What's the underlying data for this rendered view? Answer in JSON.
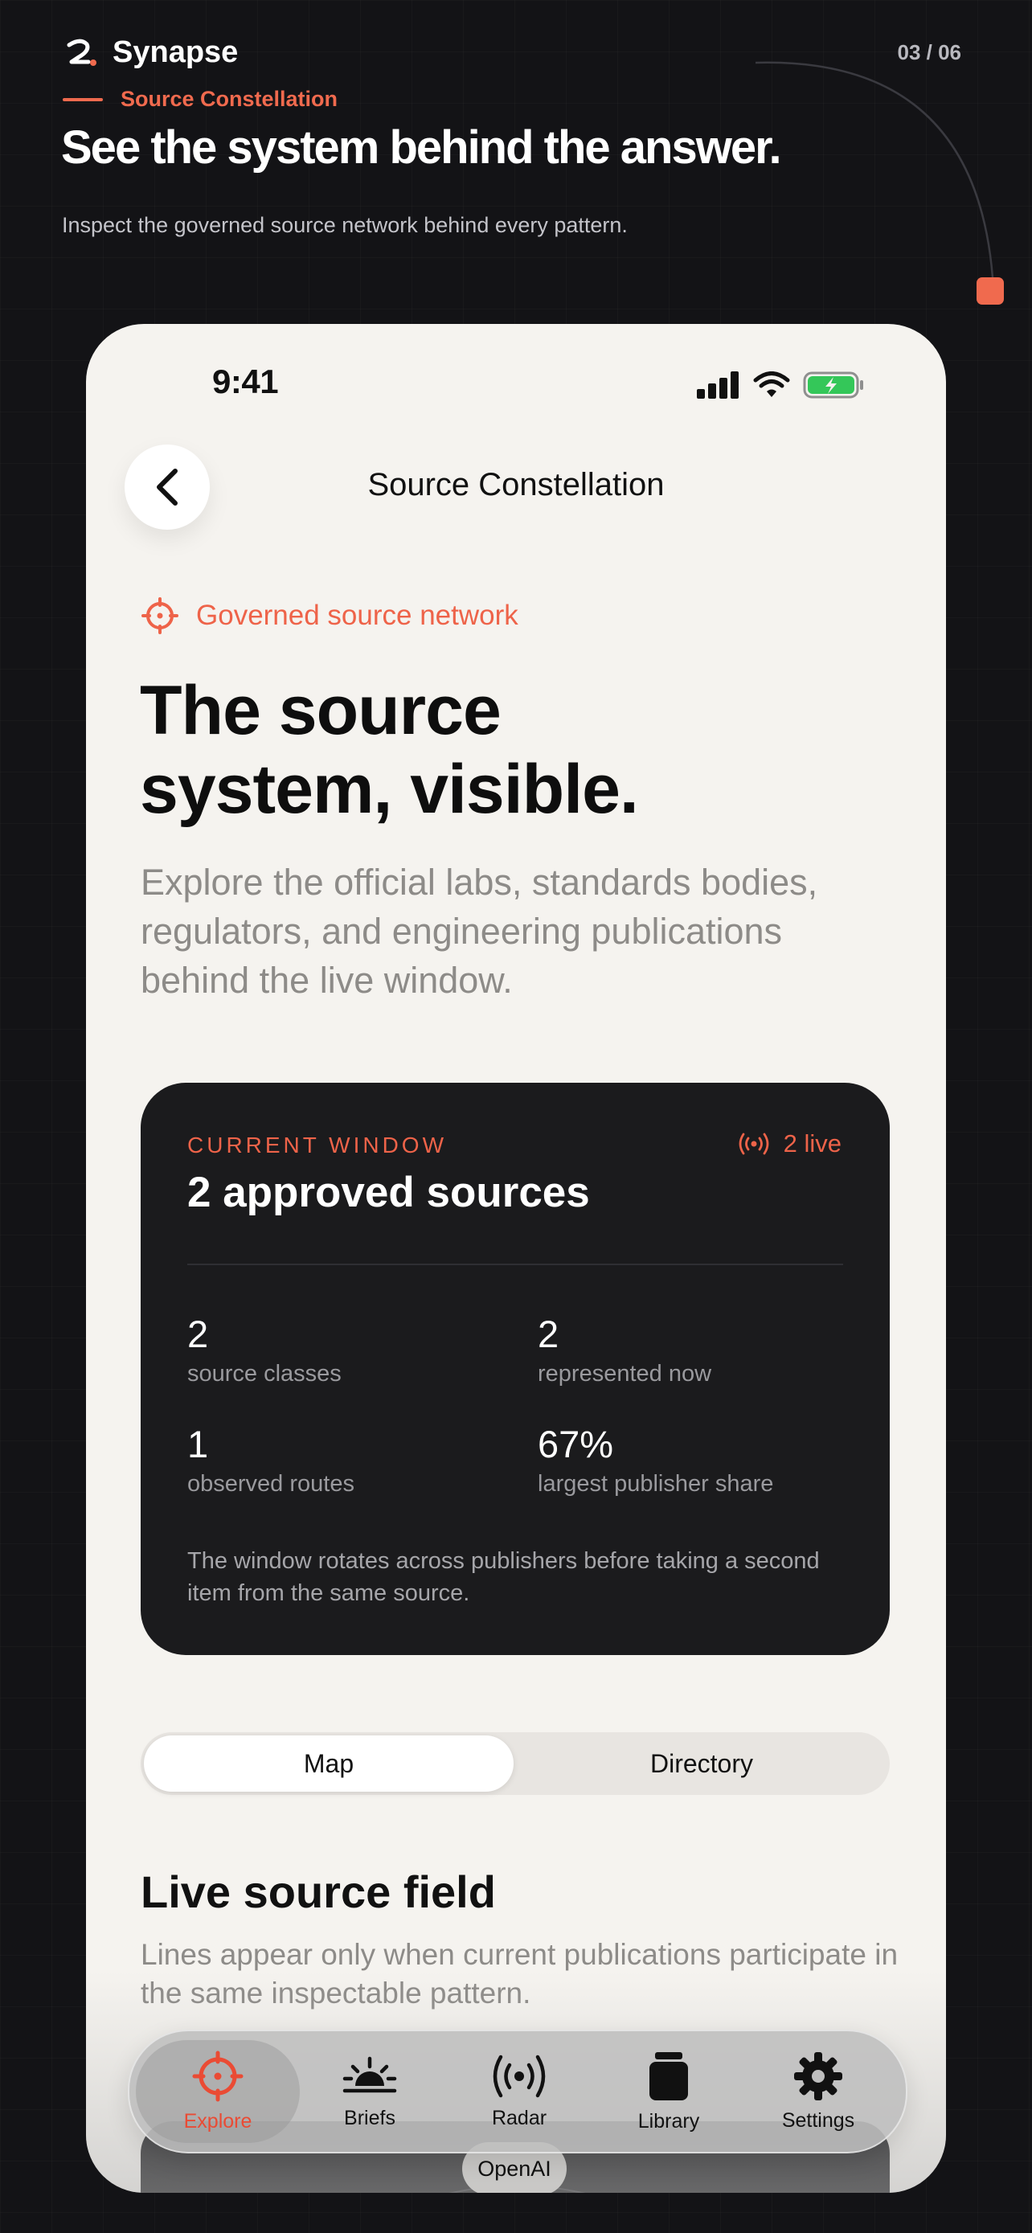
{
  "brand": {
    "name": "Synapse",
    "pager": "03 / 06"
  },
  "promo": {
    "eyebrow": "Source Constellation",
    "headline": "See the system behind the answer.",
    "subhead": "Inspect the governed source network behind every pattern."
  },
  "status_bar": {
    "time": "9:41"
  },
  "nav": {
    "title": "Source Constellation"
  },
  "hero": {
    "tag": "Governed source network",
    "title_line1": "The source",
    "title_line2": "system, visible.",
    "description": "Explore the official labs, standards bodies, regulators, and engineering publications behind the live window."
  },
  "card": {
    "eyebrow": "CURRENT WINDOW",
    "live": "2 live",
    "title": "2 approved sources",
    "stats": [
      {
        "value": "2",
        "label": "source classes"
      },
      {
        "value": "2",
        "label": "represented now"
      },
      {
        "value": "1",
        "label": "observed routes"
      },
      {
        "value": "67%",
        "label": "largest publisher share"
      }
    ],
    "note": "The window rotates across publishers before taking a second item from the same source."
  },
  "segmented": {
    "options": [
      "Map",
      "Directory"
    ],
    "selected": "Map"
  },
  "field": {
    "title": "Live source field",
    "description": "Lines appear only when current publications participate in the same inspectable pattern.",
    "node_label": "OpenAI"
  },
  "tabbar": {
    "items": [
      {
        "label": "Explore",
        "icon": "crosshair-icon"
      },
      {
        "label": "Briefs",
        "icon": "sunrise-icon"
      },
      {
        "label": "Radar",
        "icon": "broadcast-icon"
      },
      {
        "label": "Library",
        "icon": "jar-icon"
      },
      {
        "label": "Settings",
        "icon": "gear-icon"
      }
    ],
    "active": "Explore"
  },
  "colors": {
    "accent": "#EE6349",
    "background": "#131316",
    "phone": "#F5F3EF",
    "card": "#1B1B1D",
    "battery": "#34C759"
  }
}
